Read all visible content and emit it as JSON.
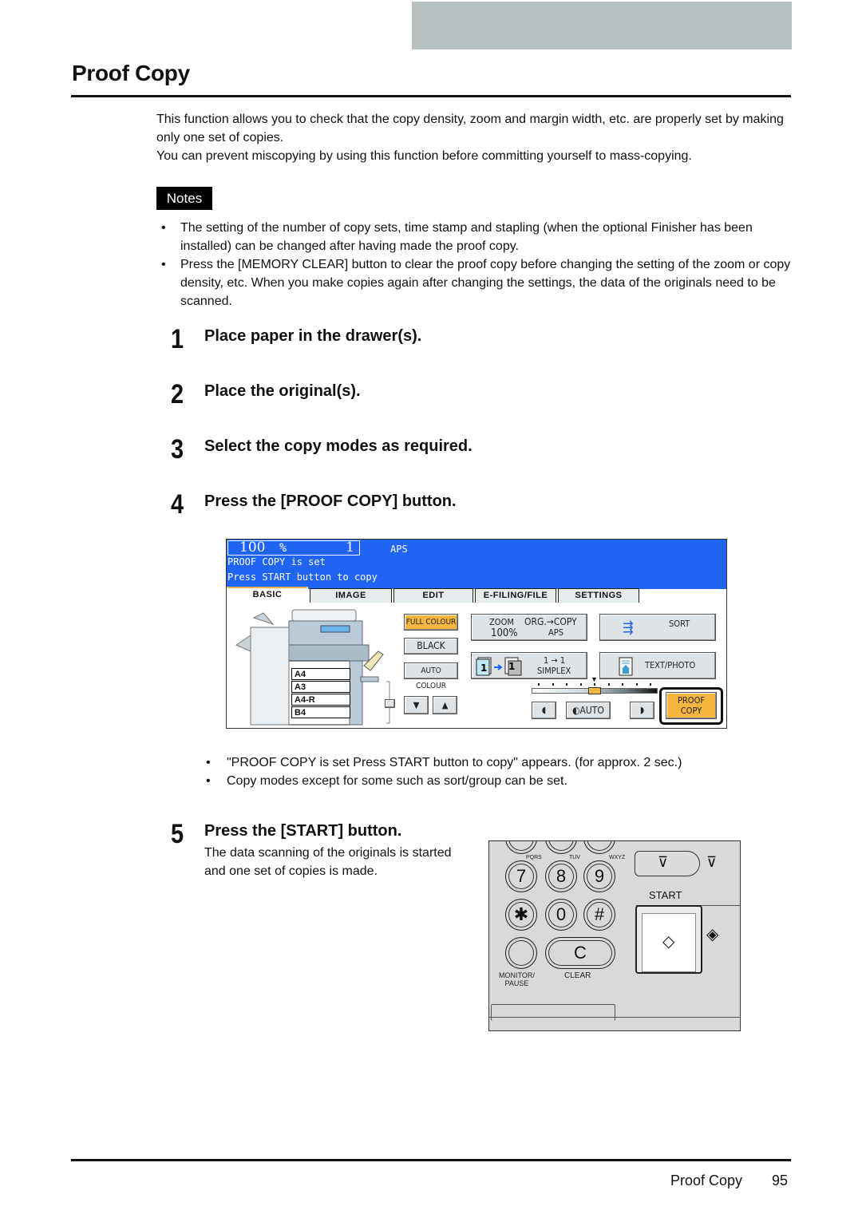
{
  "page": {
    "title": "Proof Copy",
    "intro": [
      "This function allows you to check that the copy density, zoom and margin width, etc. are properly set by making only one set of copies.",
      "You can prevent miscopying by using this function before committing yourself to mass-copying."
    ],
    "notes_label": "Notes",
    "notes": [
      "The setting of the number of copy sets, time stamp and stapling (when the optional Finisher has been installed) can be changed after having made the proof copy.",
      "Press the [MEMORY CLEAR] button to clear the proof copy before changing the setting of the zoom or copy density, etc. When you make copies again after changing the settings, the data of the originals need to be scanned."
    ],
    "steps": [
      {
        "num": "1",
        "text": "Place paper in the drawer(s)."
      },
      {
        "num": "2",
        "text": "Place the original(s)."
      },
      {
        "num": "3",
        "text": "Select the copy modes as required."
      },
      {
        "num": "4",
        "text": "Press the [PROOF COPY] button."
      },
      {
        "num": "5",
        "text": "Press the [START] button.",
        "desc": "The data scanning of the originals is started and one set of copies is made."
      }
    ],
    "step4_bullets": [
      "\"PROOF COPY is set  Press START button to copy\" appears. (for approx. 2 sec.)",
      "Copy modes except for some such as sort/group can be set."
    ],
    "footer": {
      "section": "Proof Copy",
      "page_number": "95"
    }
  },
  "lcd": {
    "zoom_value": "100",
    "zoom_unit": "%",
    "quantity": "1",
    "paper_mode": "APS",
    "message_line1": "PROOF COPY is set",
    "message_line2": "Press START button to copy",
    "tabs": [
      "BASIC",
      "IMAGE",
      "EDIT",
      "E-FILING/FILE",
      "SETTINGS"
    ],
    "active_tab": "BASIC",
    "drawers": [
      "A4",
      "A3",
      "A4-R",
      "B4"
    ],
    "colour_buttons": [
      "FULL COLOUR",
      "BLACK",
      "AUTO COLOUR"
    ],
    "selected_colour": "FULL COLOUR",
    "zoom_button": {
      "label": "ZOOM",
      "value": "100%",
      "org_copy": "ORG.→COPY",
      "org_copy_value": "APS"
    },
    "duplex_button": {
      "mode": "1 → 1",
      "label": "SIMPLEX"
    },
    "sort_label": "SORT",
    "image_mode_label": "TEXT/PHOTO",
    "density_auto_label": "AUTO",
    "density_level": 5,
    "density_levels": 9,
    "proof_copy_label": [
      "PROOF",
      "COPY"
    ],
    "colors": {
      "lcd_blue": "#1f64f2",
      "highlight_orange": "#f4b63f"
    }
  },
  "keypad": {
    "keys": [
      "7",
      "8",
      "9",
      "✱",
      "0",
      "#"
    ],
    "sublabels": [
      "PQRS",
      "TUV",
      "WXYZ"
    ],
    "clear_key": "C",
    "clear_label": "CLEAR",
    "monitor_label": "MONITOR/\nPAUSE",
    "start_label": "START"
  }
}
